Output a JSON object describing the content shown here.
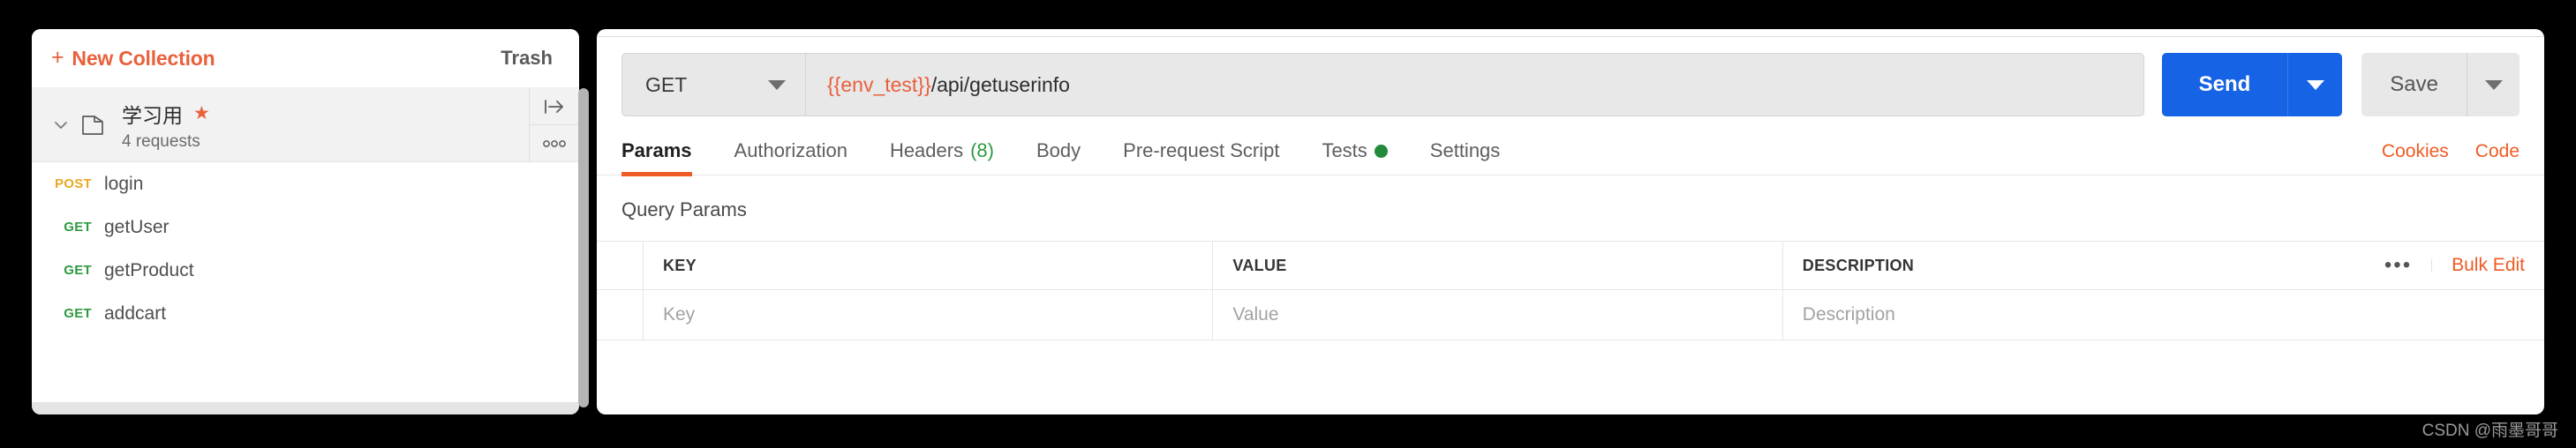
{
  "sidebar": {
    "new_collection_label": "New Collection",
    "new_collection_plus": "+",
    "trash_label": "Trash",
    "collection": {
      "name": "学习用",
      "star": "★",
      "request_count_label": "4 requests",
      "run_icon_glyph": "|→",
      "more_icon_glyph": "ᴑᴑᴑ"
    },
    "requests": [
      {
        "method": "POST",
        "name": "login"
      },
      {
        "method": "GET",
        "name": "getUser"
      },
      {
        "method": "GET",
        "name": "getProduct"
      },
      {
        "method": "GET",
        "name": "addcart"
      }
    ]
  },
  "request_bar": {
    "method": "GET",
    "url_variable": "{{env_test}}",
    "url_path": "/api/getuserinfo",
    "send_label": "Send",
    "save_label": "Save"
  },
  "tabs": {
    "items": [
      {
        "label": "Params",
        "active": true
      },
      {
        "label": "Authorization",
        "active": false
      },
      {
        "label": "Headers",
        "active": false,
        "count": "(8)"
      },
      {
        "label": "Body",
        "active": false
      },
      {
        "label": "Pre-request Script",
        "active": false
      },
      {
        "label": "Tests",
        "active": false,
        "dot": true
      },
      {
        "label": "Settings",
        "active": false
      }
    ],
    "cookies_label": "Cookies",
    "code_label": "Code"
  },
  "query_params": {
    "section_title": "Query Params",
    "headers": {
      "key": "KEY",
      "value": "VALUE",
      "description": "DESCRIPTION"
    },
    "rows": [
      {
        "key": "Key",
        "value": "Value",
        "description": "Description"
      }
    ],
    "more_glyph": "•••",
    "bulk_edit_label": "Bulk Edit"
  },
  "watermark": "CSDN @雨墨哥哥",
  "colors": {
    "accent_orange": "#ef5b25",
    "brand_orange": "#e8603c",
    "send_blue": "#1763e6",
    "get_green": "#2d9a41",
    "post_yellow": "#e9a825"
  }
}
